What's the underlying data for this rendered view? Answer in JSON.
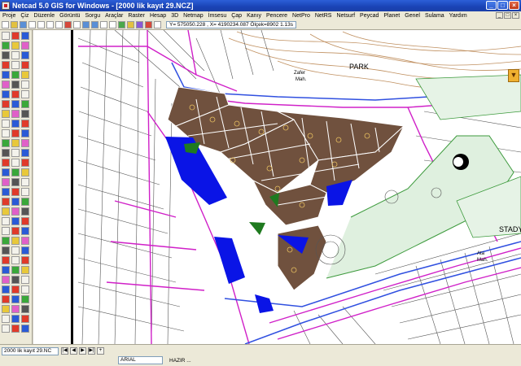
{
  "window": {
    "title": "Netcad 5.0 GIS for Windows - [2000 lik kayıt 29.NCZ]",
    "buttons": [
      "_",
      "□",
      "×"
    ]
  },
  "menu": {
    "items": [
      "Proje",
      "Çiz",
      "Düzenle",
      "Görüntü",
      "Sorgu",
      "Araçlar",
      "Raster",
      "Hesap",
      "3D",
      "Netmap",
      "İmsesu",
      "Çap",
      "Kanıy",
      "Pencere",
      "NetPro",
      "NetRS",
      "Netsurf",
      "Peycad",
      "Planet",
      "Genel",
      "Sulama",
      "Yardım"
    ],
    "mdi_buttons": [
      "_",
      "□",
      "×"
    ]
  },
  "toolbar": {
    "coordinates": "Y= 575050.228 , X= 4190234.087 Ölçek=8902   1.13s"
  },
  "map": {
    "labels": {
      "park": "PARK",
      "zafer": "Zafer",
      "zafer_mah": "Mah.",
      "stadyum": "STADY",
      "ata": "Ata",
      "ata_mah": "Mah."
    }
  },
  "statusbar": {
    "file_name": "2000 lik kayıt 29.NC",
    "font_name": "ARIAL",
    "status": "HAZIR ..."
  },
  "colors": {
    "parcel": "#70513e",
    "water": "#0a14e6",
    "green": "#1f7a1f",
    "road_magenta": "#d020c8",
    "road_blue": "#3050e0",
    "contour": "#c09060",
    "park_green": "#3c9a3c"
  }
}
